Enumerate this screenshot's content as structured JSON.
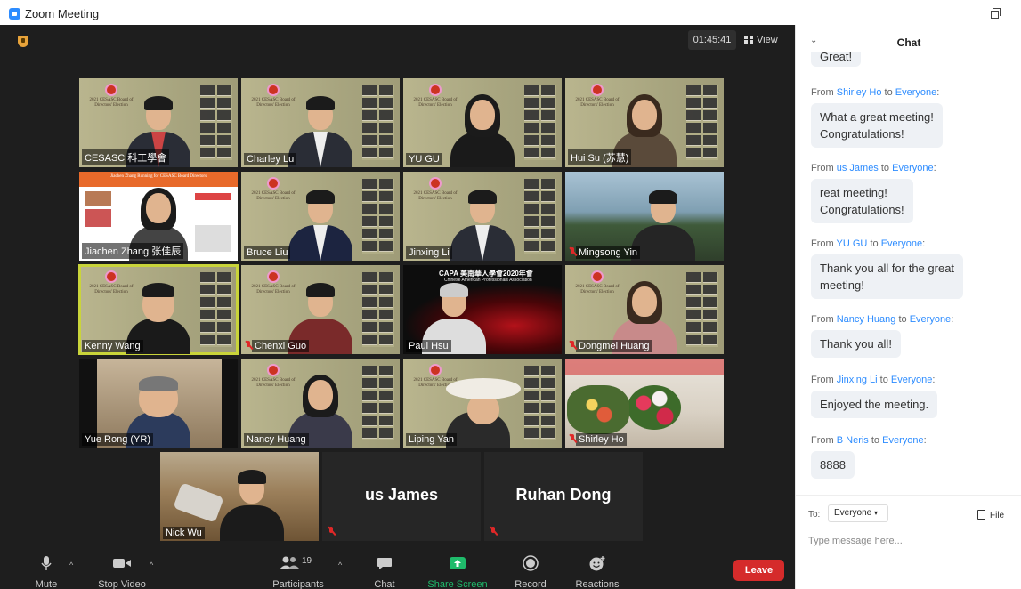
{
  "window": {
    "title": "Zoom Meeting"
  },
  "meeting": {
    "timer": "01:45:41",
    "view_label": "View",
    "slide_text": "2021 CESASC Board of Directors' Election"
  },
  "participants": [
    {
      "name": "CESASC 科工學會"
    },
    {
      "name": "Charley Lu"
    },
    {
      "name": "YU GU"
    },
    {
      "name": "Hui Su (苏慧)"
    },
    {
      "name": "Jiachen Zhang 张佳辰",
      "banner": "Jiachen Zhang Running for CESASC Board Directors"
    },
    {
      "name": "Bruce Liu"
    },
    {
      "name": "Jinxing Li"
    },
    {
      "name": "Mingsong Yin"
    },
    {
      "name": "Kenny Wang"
    },
    {
      "name": "Chenxi Guo"
    },
    {
      "name": "Paul Hsu",
      "logo": "CAPA 美南華人學會2020年會",
      "sub": "Chinese American Professionals Association"
    },
    {
      "name": "Dongmei Huang"
    },
    {
      "name": "Yue Rong (YR)"
    },
    {
      "name": "Nancy Huang"
    },
    {
      "name": "Liping Yan"
    },
    {
      "name": "Shirley Ho"
    },
    {
      "name": "Nick Wu"
    },
    {
      "name": "us James"
    },
    {
      "name": "Ruhan Dong"
    }
  ],
  "toolbar": {
    "mute": "Mute",
    "stop_video": "Stop Video",
    "participants": "Participants",
    "participants_count": "19",
    "chat": "Chat",
    "share_screen": "Share Screen",
    "record": "Record",
    "reactions": "Reactions",
    "leave": "Leave"
  },
  "chat": {
    "title": "Chat",
    "partial_message": "Great!",
    "from_word": "From",
    "to_word": "to",
    "messages": [
      {
        "from": "Shirley Ho",
        "to": "Everyone",
        "text": "What a great meeting!\nCongratulations!"
      },
      {
        "from": "us James",
        "to": "Everyone",
        "text": "reat meeting!\nCongratulations!"
      },
      {
        "from": "YU GU",
        "to": "Everyone",
        "text": "Thank you all for the great\nmeeting!"
      },
      {
        "from": "Nancy Huang",
        "to": "Everyone",
        "text": "Thank you all!"
      },
      {
        "from": "Jinxing Li",
        "to": "Everyone",
        "text": "Enjoyed the meeting."
      },
      {
        "from": "B Neris",
        "to": "Everyone",
        "text": "8888"
      }
    ],
    "to_label": "To:",
    "recipient": "Everyone",
    "file_label": "File",
    "placeholder": "Type message here..."
  },
  "colors": {
    "accent": "#2d8cff",
    "leave": "#d52b2b",
    "share": "#1fbb6b",
    "active_speaker": "#c9d43a"
  }
}
